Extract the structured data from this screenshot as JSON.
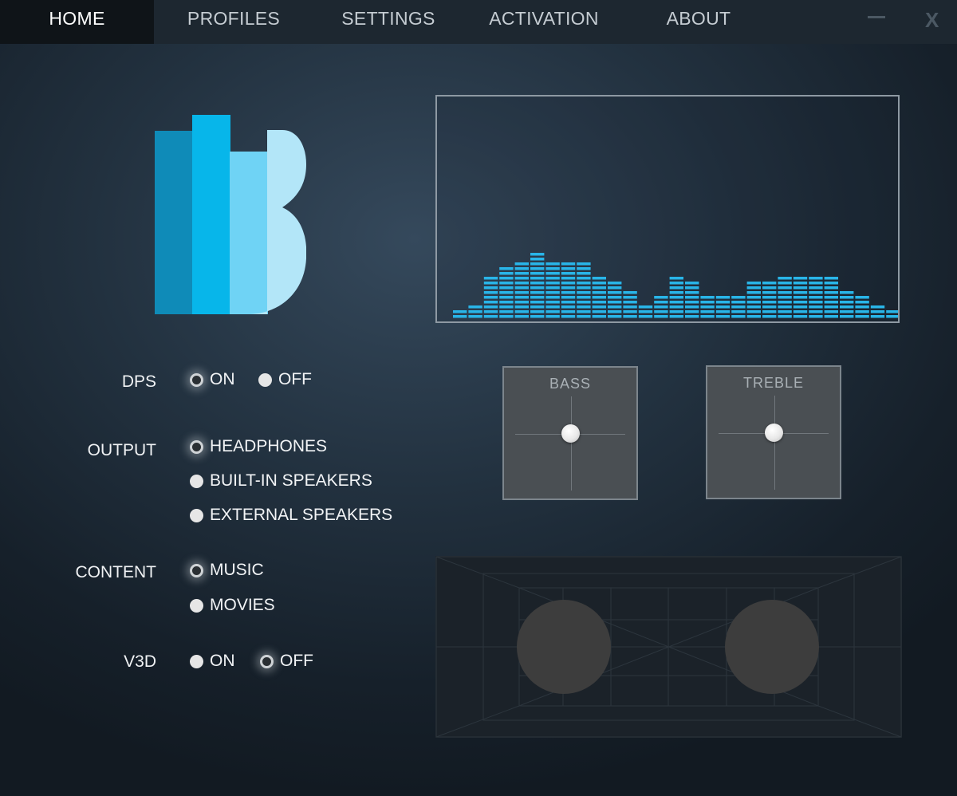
{
  "nav": {
    "tabs": [
      "HOME",
      "PROFILES",
      "SETTINGS",
      "ACTIVATION",
      "ABOUT"
    ],
    "active": "HOME",
    "minimize_icon": "minimize-icon",
    "close_label": "X"
  },
  "colors": {
    "accent": "#29b5e8",
    "logo": [
      "#0f8bb8",
      "#07b6ea",
      "#6fd3f5",
      "#b3e6f8"
    ]
  },
  "dps": {
    "label": "DPS",
    "options": [
      "ON",
      "OFF"
    ],
    "selected": "ON"
  },
  "output": {
    "label": "OUTPUT",
    "options": [
      "HEADPHONES",
      "BUILT-IN SPEAKERS",
      "EXTERNAL SPEAKERS"
    ],
    "selected": "HEADPHONES"
  },
  "content": {
    "label": "CONTENT",
    "options": [
      "MUSIC",
      "MOVIES"
    ],
    "selected": "MUSIC"
  },
  "v3d": {
    "label": "V3D",
    "options": [
      "ON",
      "OFF"
    ],
    "selected": "OFF"
  },
  "bass": {
    "label": "BASS"
  },
  "treble": {
    "label": "TREBLE"
  },
  "spectrum": {
    "levels": [
      1,
      2,
      6,
      7,
      8,
      9,
      8,
      8,
      8,
      6,
      5,
      4,
      2,
      3,
      6,
      5,
      3,
      3,
      3,
      5,
      5,
      6,
      6,
      6,
      6,
      4,
      3,
      2,
      1,
      1
    ]
  }
}
